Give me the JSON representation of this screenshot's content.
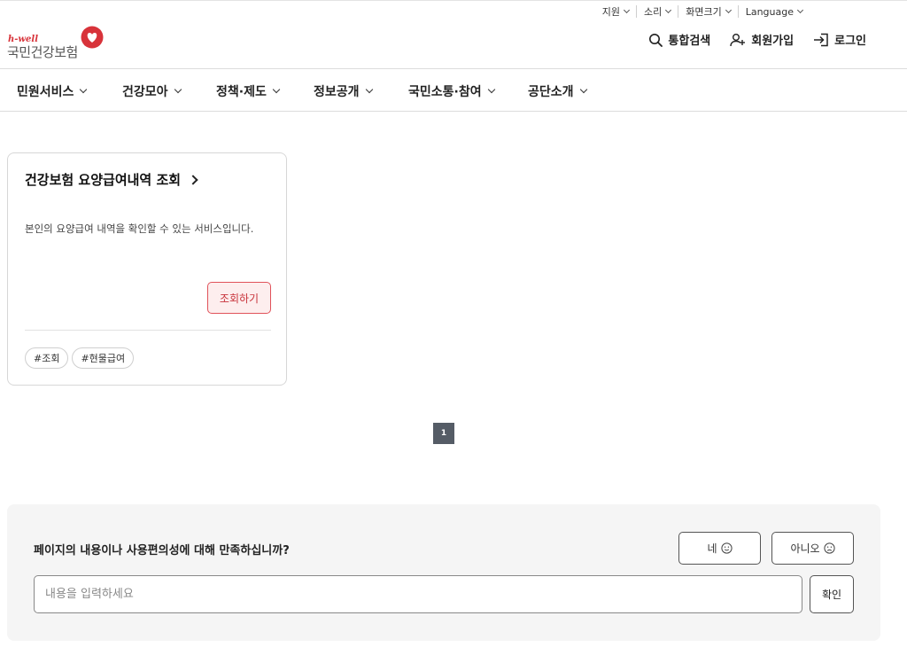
{
  "utility_bar": {
    "items": [
      {
        "label": "지원"
      },
      {
        "label": "소리"
      },
      {
        "label": "화면크기"
      },
      {
        "label": "Language"
      }
    ]
  },
  "logo": {
    "tagline": "h-well",
    "name": "국민건강보험",
    "brand_color": "#d8333a"
  },
  "header_actions": {
    "search": {
      "label": "통합검색",
      "icon": "search-icon"
    },
    "signup": {
      "label": "회원가입",
      "icon": "user-plus-icon"
    },
    "login": {
      "label": "로그인",
      "icon": "login-icon"
    }
  },
  "nav": {
    "items": [
      {
        "label": "민원서비스"
      },
      {
        "label": "건강모아"
      },
      {
        "label": "정책·제도"
      },
      {
        "label": "정보공개"
      },
      {
        "label": "국민소통·참여"
      },
      {
        "label": "공단소개"
      }
    ]
  },
  "service_card": {
    "title": "건강보험 요양급여내역 조회",
    "description": "본인의 요양급여 내역을 확인할 수 있는 서비스입니다.",
    "action_label": "조회하기",
    "tags": [
      "#조회",
      "#현물급여"
    ]
  },
  "pagination": {
    "current_page": "1"
  },
  "survey": {
    "question": "페이지의 내용이나 사용편의성에 대해 만족하십니까?",
    "yes_label": "네",
    "no_label": "아니오",
    "input_placeholder": "내용을 입력하세요",
    "input_value": "",
    "submit_label": "확인"
  },
  "colors": {
    "accent": "#d8333a",
    "accent_bg": "#fdeeee",
    "pager_bg": "#555c66",
    "survey_bg": "#f5f5f5"
  }
}
